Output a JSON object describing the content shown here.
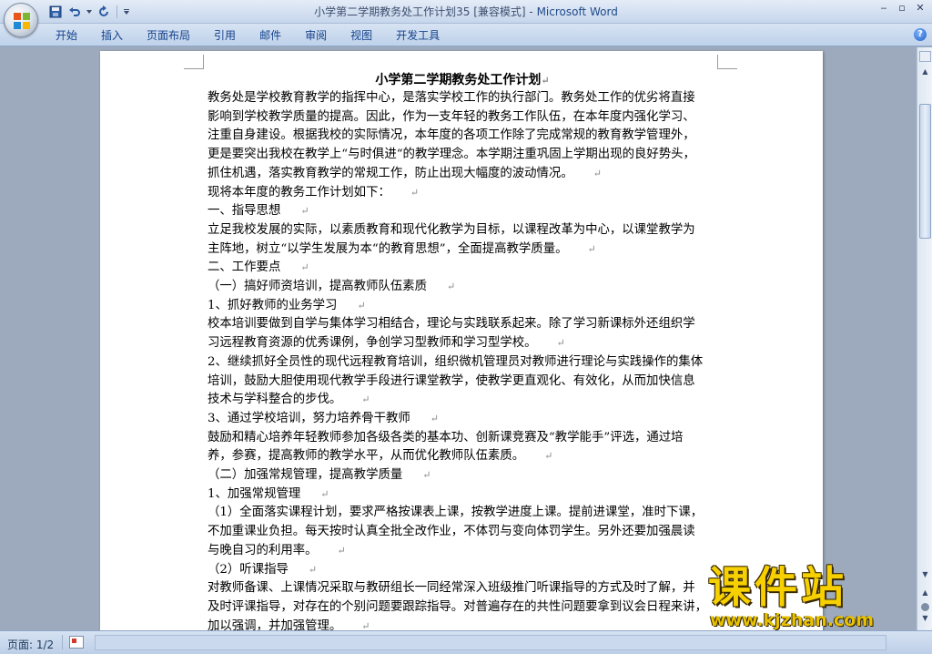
{
  "window": {
    "doc_name": "小学第二学期教务处工作计划35 [兼容模式] - ",
    "app_name": "Microsoft Word",
    "minimize": "‒",
    "restore": "▫",
    "close": "✕"
  },
  "ribbon_tabs": [
    "开始",
    "插入",
    "页面布局",
    "引用",
    "邮件",
    "审阅",
    "视图",
    "开发工具"
  ],
  "document": {
    "title": "小学第二学期教务处工作计划",
    "lines": [
      "教务处是学校教育教学的指挥中心，是落实学校工作的执行部门。教务处工作的优劣将直接",
      "影响到学校教学质量的提高。因此，作为一支年轻的教务工作队伍，在本年度内强化学习、",
      "注重自身建设。根据我校的实际情况，本年度的各项工作除了完成常规的教育教学管理外，",
      "更是要突出我校在教学上“与时俱进“的教学理念。本学期注重巩固上学期出现的良好势头，",
      "抓住机遇，落实教育教学的常规工作，防止出现大幅度的波动情况。",
      "现将本年度的教务工作计划如下：",
      "一、指导思想",
      "立足我校发展的实际，以素质教育和现代化教学为目标，以课程改革为中心，以课堂教学为",
      "主阵地，树立“以学生发展为本“的教育思想”，全面提高教学质量。",
      "二、工作要点",
      "（一）搞好师资培训，提高教师队伍素质",
      "1、抓好教师的业务学习",
      "校本培训要做到自学与集体学习相结合，理论与实践联系起来。除了学习新课标外还组织学",
      "习远程教育资源的优秀课例，争创学习型教师和学习型学校。",
      "2、继续抓好全员性的现代远程教育培训，组织微机管理员对教师进行理论与实践操作的集体",
      "培训，鼓励大胆使用现代教学手段进行课堂教学，使教学更直观化、有效化，从而加快信息",
      "技术与学科整合的步伐。",
      "3、通过学校培训，努力培养骨干教师",
      "鼓励和精心培养年轻教师参加各级各类的基本功、创新课竞赛及“教学能手”评选，通过培",
      "养，参赛，提高教师的教学水平，从而优化教师队伍素质。",
      "（二）加强常规管理，提高教学质量",
      "1、加强常规管理",
      "（1）全面落实课程计划，要求严格按课表上课，按教学进度上课。提前进课堂，准时下课，",
      "不加重课业负担。每天按时认真全批全改作业，不体罚与变向体罚学生。另外还要加强晨读",
      "与晚自习的利用率。",
      "（2）听课指导",
      "对教师备课、上课情况采取与教研组长一同经常深入班级推门听课指导的方式及时了解，并",
      "及时评课指导，对存在的个别问题要跟踪指导。对普遍存在的共性问题要拿到议会日程来讲，",
      "加以强调，并加强管理。"
    ],
    "paragraph_mark": "↵"
  },
  "status": {
    "page": "页面: 1/2"
  },
  "watermark": {
    "main": "课件站",
    "url": "www.kjzhan.com"
  },
  "colors": {
    "tab_text": "#15428b",
    "watermark": "#f6d000"
  }
}
